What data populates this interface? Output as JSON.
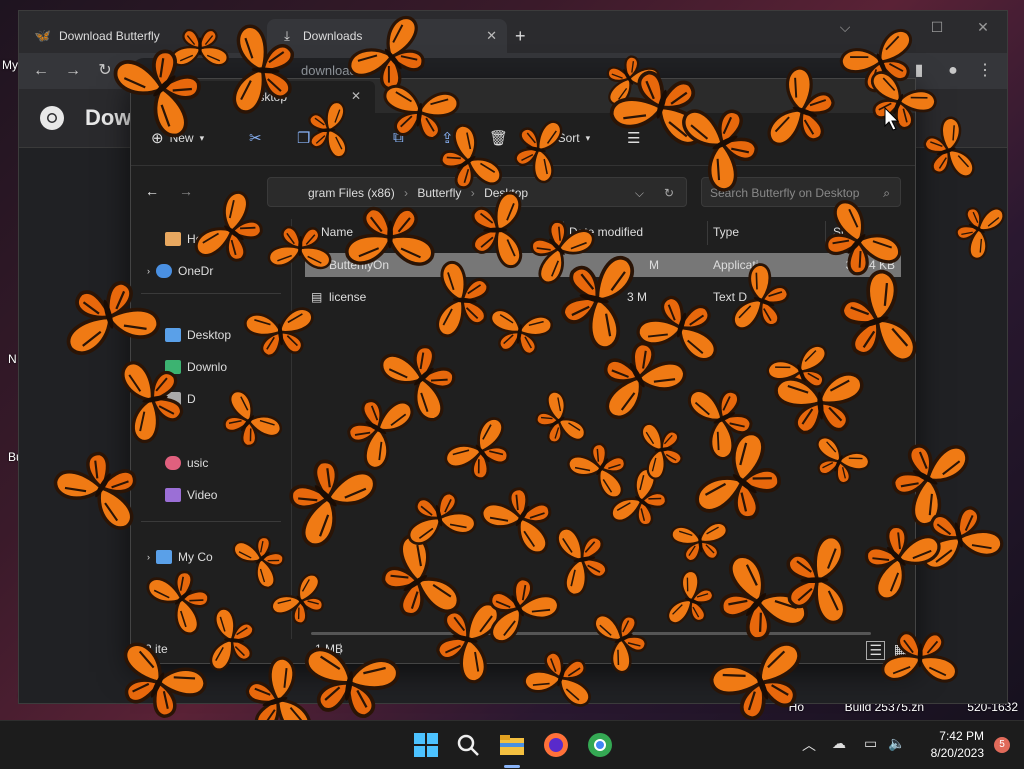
{
  "desktop": {
    "labels": [
      "My",
      "N",
      "Bu"
    ],
    "watermark_left": "Ho",
    "watermark_build": "Build 25375.zn",
    "watermark_right": "520-1632",
    "watermark_top": "ew"
  },
  "chrome": {
    "tabs": [
      {
        "label": "Download Butterfly"
      },
      {
        "label": "Downloads"
      }
    ],
    "new_tab_symbol": "+",
    "url": "downloads",
    "page_title": "Dow"
  },
  "explorer": {
    "tab_title": "Desktop",
    "commands": {
      "new": "New",
      "sort": "Sort"
    },
    "address": {
      "segments": [
        "gram Files (x86)",
        "Butterfly",
        "Desktop"
      ]
    },
    "search_placeholder": "Search Butterfly on Desktop",
    "nav": [
      {
        "label": "Hom",
        "color": "#e8a860"
      },
      {
        "label": "OneDr",
        "color": "#4a90e2"
      },
      {
        "label": "Desktop",
        "color": "#5aa0e8"
      },
      {
        "label": "Downlo",
        "color": "#3cb371"
      },
      {
        "label": "D",
        "color": "#aaaaaa"
      },
      {
        "label": "usic",
        "color": "#e0607e"
      },
      {
        "label": "Video",
        "color": "#9b6fd6"
      },
      {
        "label": "My Co",
        "color": "#5aa0e8"
      }
    ],
    "columns": {
      "name": "Name",
      "date": "Date modified",
      "type": "Type",
      "size": "Size"
    },
    "files": [
      {
        "name": "ButterflyOn",
        "date": "M",
        "type": "Applicati",
        "size": "3,084 KB"
      },
      {
        "name": "license",
        "date": "3 M",
        "type": "Text D",
        "size": "2 K"
      }
    ],
    "status_items": "2 ite",
    "status_size": "1 MB"
  },
  "taskbar": {
    "time": "7:42 PM",
    "date": "8/20/2023",
    "notification_count": "5"
  },
  "colors": {
    "butterfly_orange": "#f07a14",
    "butterfly_dark": "#2a1406",
    "accent_blue": "#8ab4f8"
  }
}
